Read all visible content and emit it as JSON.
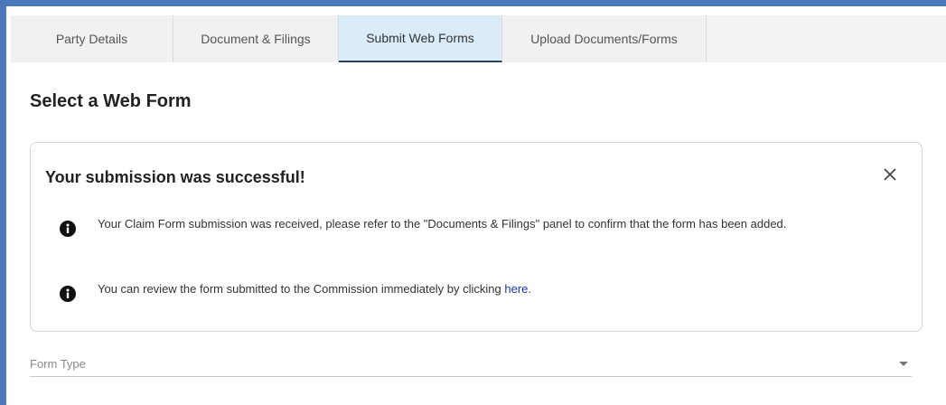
{
  "tabs": [
    {
      "label": "Party Details"
    },
    {
      "label": "Document & Filings"
    },
    {
      "label": "Submit Web Forms"
    },
    {
      "label": "Upload Documents/Forms"
    }
  ],
  "active_tab": "Submit Web Forms",
  "page": {
    "title": "Select a Web Form"
  },
  "alert": {
    "title": "Your submission was successful!",
    "close_icon": "close-icon",
    "messages": [
      {
        "icon": "info-icon",
        "text": "Your Claim Form submission was received, please refer to the \"Documents & Filings\" panel to confirm that the form has been added."
      },
      {
        "icon": "info-icon",
        "text_before": "You can review the form submitted to the Commission immediately by clicking ",
        "link_text": "here",
        "text_after": "."
      }
    ]
  },
  "form_type": {
    "placeholder": "Form Type",
    "value": ""
  },
  "colors": {
    "accent": "#4a78b8",
    "active_tab_bg": "#d9ecf7",
    "active_tab_underline": "#2b3f63",
    "link": "#1a35b8"
  }
}
